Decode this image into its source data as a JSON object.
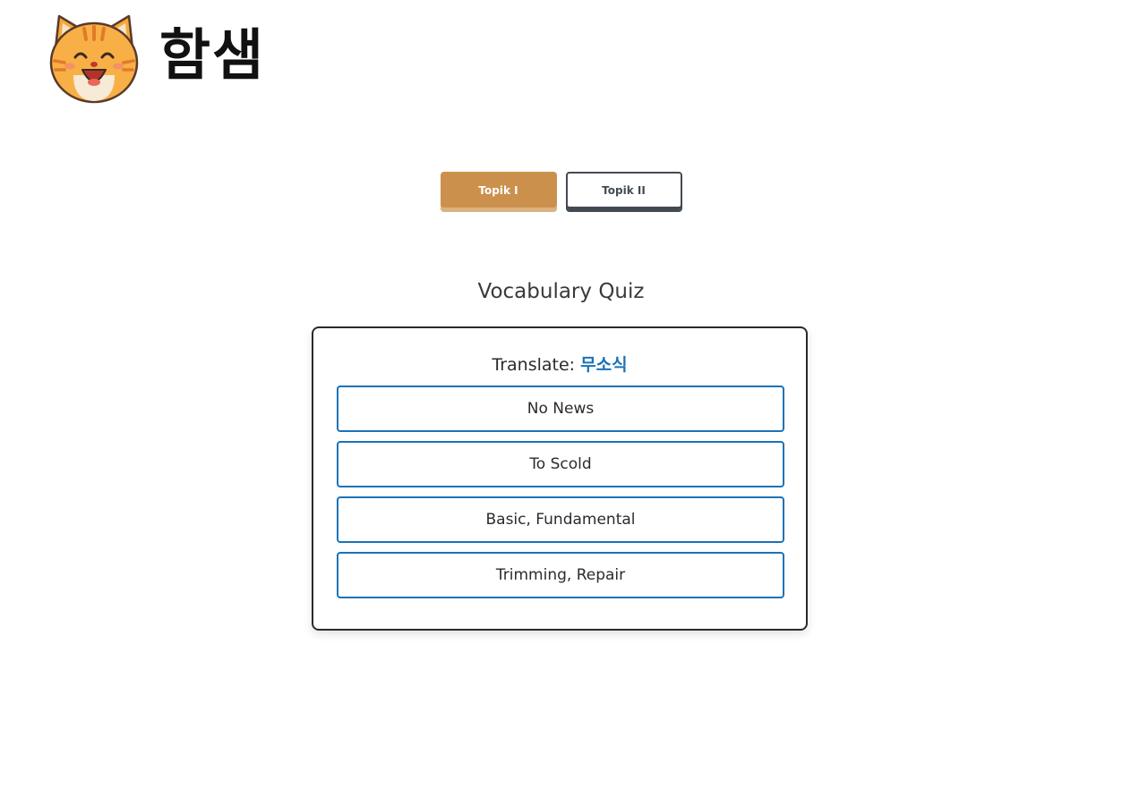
{
  "header": {
    "logo_icon": "cat-face-icon",
    "logo_text": "함샘"
  },
  "level_tabs": [
    {
      "label": "Topik I",
      "active": true
    },
    {
      "label": "Topik II",
      "active": false
    }
  ],
  "quiz": {
    "title": "Vocabulary Quiz",
    "prompt_label": "Translate:",
    "word": "무소식",
    "answers": [
      "No News",
      "To Scold",
      "Basic, Fundamental",
      "Trimming, Repair"
    ]
  },
  "colors": {
    "accent": "#cb914c",
    "dark": "#444a52",
    "link_blue": "#1a73b8"
  }
}
